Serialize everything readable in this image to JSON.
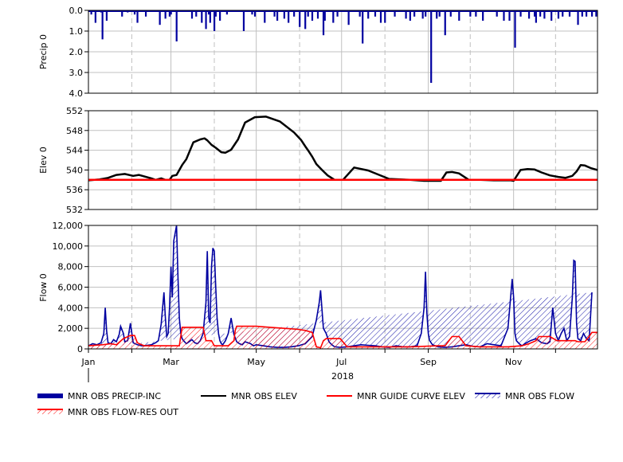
{
  "chart_data": [
    {
      "type": "bar",
      "ylabel": "Precip 0",
      "ylim": [
        0,
        4
      ],
      "y_inverted": true,
      "yticks": [
        "0.0",
        "1.0",
        "2.0",
        "3.0",
        "4.0"
      ],
      "grid": true,
      "series": [
        {
          "name": "MNR OBS PRECIP-INC",
          "color": "#0000a0",
          "x_day": [
            2,
            5,
            9,
            10,
            13,
            24,
            28,
            33,
            35,
            41,
            51,
            55,
            58,
            59,
            63,
            74,
            77,
            81,
            84,
            86,
            87,
            90,
            91,
            94,
            99,
            111,
            117,
            119,
            126,
            133,
            135,
            140,
            143,
            147,
            151,
            155,
            157,
            160,
            164,
            168,
            169,
            175,
            178,
            186,
            194,
            196,
            200,
            205,
            209,
            212,
            219,
            227,
            230,
            233,
            239,
            241,
            245,
            249,
            251,
            255,
            259,
            265,
            273,
            277,
            282,
            292,
            297,
            301,
            305,
            309,
            315,
            319,
            320,
            323,
            326,
            331,
            336,
            339,
            344,
            350,
            353,
            356,
            360,
            363
          ],
          "values": [
            0.2,
            0.6,
            0.1,
            1.4,
            0.5,
            0.3,
            0.1,
            0.2,
            0.6,
            0.3,
            0.7,
            0.4,
            0.3,
            0.2,
            1.5,
            0.4,
            0.3,
            0.6,
            0.9,
            0.2,
            0.6,
            1.0,
            0.3,
            0.5,
            0.2,
            1.0,
            0.2,
            0.3,
            0.6,
            0.3,
            0.5,
            0.4,
            0.6,
            0.3,
            0.8,
            0.9,
            0.3,
            0.5,
            0.4,
            1.2,
            0.5,
            0.6,
            0.3,
            0.7,
            0.3,
            1.6,
            0.4,
            0.3,
            0.6,
            0.6,
            0.3,
            0.4,
            0.5,
            0.3,
            0.4,
            0.3,
            3.5,
            0.4,
            0.3,
            1.2,
            0.3,
            0.5,
            0.3,
            0.3,
            0.5,
            0.3,
            0.5,
            0.5,
            1.8,
            0.3,
            0.4,
            0.3,
            0.6,
            0.3,
            0.4,
            0.5,
            0.4,
            0.3,
            0.3,
            0.7,
            0.3,
            0.3,
            0.3,
            0.3
          ]
        }
      ]
    },
    {
      "type": "line",
      "ylabel": "Elev 0",
      "ylim": [
        532,
        552
      ],
      "yticks": [
        "532",
        "536",
        "540",
        "544",
        "548",
        "552"
      ],
      "grid": true,
      "series": [
        {
          "name": "MNR OBS ELEV",
          "color": "#000000",
          "x_day": [
            0,
            8,
            14,
            20,
            26,
            32,
            36,
            45,
            48,
            52,
            55,
            58,
            60,
            63,
            67,
            70,
            75,
            80,
            83,
            85,
            88,
            91,
            95,
            98,
            102,
            107,
            112,
            119,
            127,
            137,
            147,
            152,
            155,
            157,
            160,
            163,
            167,
            171,
            176,
            182,
            190,
            200,
            215,
            230,
            240,
            244,
            248,
            252,
            256,
            260,
            265,
            272,
            280,
            290,
            302,
            304,
            309,
            314,
            319,
            324,
            330,
            336,
            341,
            346,
            349,
            352,
            355,
            359,
            364
          ],
          "values": [
            537.9,
            538.1,
            538.4,
            539.0,
            539.2,
            538.8,
            539.0,
            538.3,
            538.0,
            538.3,
            538.0,
            538.0,
            538.8,
            539.0,
            541.0,
            542.2,
            545.6,
            546.2,
            546.4,
            546.0,
            545.1,
            544.5,
            543.6,
            543.5,
            544.1,
            546.2,
            549.6,
            550.7,
            550.8,
            549.8,
            547.6,
            546.1,
            544.8,
            544.0,
            542.7,
            541.2,
            540.0,
            538.9,
            538.0,
            538.0,
            540.5,
            539.9,
            538.2,
            538.0,
            537.8,
            537.8,
            537.8,
            537.8,
            539.5,
            539.6,
            539.3,
            538.0,
            538.0,
            537.9,
            537.9,
            537.8,
            540.0,
            540.2,
            540.1,
            539.5,
            538.9,
            538.6,
            538.4,
            538.8,
            539.7,
            541.0,
            540.9,
            540.4,
            540.0
          ]
        },
        {
          "name": "MNR GUIDE CURVE ELEV",
          "color": "#ff0000",
          "x_day": [
            0,
            364
          ],
          "values": [
            538.0,
            538.0
          ]
        }
      ]
    },
    {
      "type": "area",
      "ylabel": "Flow 0",
      "xlabel": "2018",
      "ylim": [
        0,
        12000
      ],
      "yticks": [
        "0",
        "2,000",
        "4,000",
        "6,000",
        "8,000",
        "10,000",
        "12,000"
      ],
      "x_tick_labels": [
        "Jan",
        "Mar",
        "May",
        "Jul",
        "Sep",
        "Nov"
      ],
      "grid": true,
      "series": [
        {
          "name": "MNR OBS FLOW",
          "color": "#0000a0",
          "fill": "hatched",
          "x_day": [
            0,
            3,
            6,
            9,
            11,
            12,
            13,
            14,
            16,
            18,
            20,
            22,
            23,
            25,
            26,
            28,
            30,
            32,
            35,
            38,
            40,
            45,
            48,
            50,
            52,
            54,
            55,
            56,
            57,
            58,
            59,
            60,
            61,
            63,
            64,
            65,
            66,
            67,
            68,
            70,
            72,
            74,
            76,
            78,
            80,
            82,
            84,
            85,
            86,
            87,
            88,
            89,
            90,
            91,
            92,
            93,
            94,
            95,
            96,
            98,
            100,
            102,
            104,
            106,
            108,
            110,
            112,
            114,
            116,
            118,
            120,
            125,
            130,
            135,
            140,
            145,
            150,
            155,
            160,
            163,
            165,
            166,
            168,
            170,
            172,
            174,
            176,
            180,
            185,
            190,
            195,
            200,
            205,
            210,
            215,
            220,
            225,
            230,
            235,
            238,
            240,
            241,
            242,
            243,
            244,
            246,
            248,
            250,
            255,
            260,
            265,
            270,
            275,
            280,
            285,
            290,
            295,
            300,
            303,
            304,
            305,
            306,
            308,
            310,
            312,
            316,
            320,
            324,
            328,
            330,
            332,
            334,
            336,
            338,
            340,
            342,
            344,
            346,
            347,
            348,
            349,
            350,
            352,
            354,
            356,
            358,
            360,
            362,
            364
          ],
          "values": [
            300,
            500,
            400,
            600,
            1500,
            4000,
            1800,
            600,
            500,
            900,
            700,
            1400,
            2200,
            1500,
            700,
            800,
            2500,
            600,
            400,
            300,
            300,
            400,
            600,
            800,
            2400,
            5500,
            3000,
            1200,
            1500,
            4000,
            8000,
            5000,
            10500,
            12000,
            7000,
            3000,
            1500,
            1000,
            800,
            500,
            700,
            900,
            600,
            500,
            800,
            1500,
            4500,
            9500,
            3000,
            2500,
            8000,
            9800,
            9500,
            6000,
            3000,
            1500,
            800,
            500,
            400,
            800,
            1500,
            3000,
            1400,
            700,
            500,
            400,
            700,
            600,
            500,
            300,
            400,
            300,
            200,
            150,
            150,
            200,
            300,
            500,
            1200,
            2800,
            4500,
            5700,
            2000,
            1500,
            700,
            400,
            200,
            150,
            200,
            300,
            400,
            350,
            300,
            200,
            150,
            300,
            200,
            200,
            300,
            1500,
            4000,
            7500,
            3500,
            1500,
            800,
            400,
            300,
            200,
            150,
            200,
            300,
            400,
            250,
            200,
            500,
            400,
            300,
            2000,
            6800,
            5000,
            1500,
            800,
            500,
            300,
            500,
            800,
            1000,
            600,
            500,
            700,
            4000,
            1500,
            800,
            1500,
            2000,
            800,
            1200,
            5000,
            8600,
            8500,
            2500,
            1000,
            800,
            1500,
            1000,
            800,
            5500
          ]
        },
        {
          "name": "MNR OBS FLOW-RES OUT",
          "color": "#ff0000",
          "fill": "hatched",
          "x_day": [
            0,
            10,
            16,
            20,
            25,
            30,
            33,
            35,
            38,
            40,
            48,
            55,
            65,
            67,
            68,
            70,
            82,
            84,
            86,
            87,
            88,
            90,
            91,
            92,
            94,
            100,
            104,
            105,
            106,
            108,
            115,
            120,
            130,
            140,
            150,
            155,
            160,
            163,
            165,
            166,
            168,
            170,
            175,
            180,
            185,
            190,
            200,
            230,
            250,
            255,
            260,
            262,
            265,
            270,
            280,
            300,
            310,
            315,
            320,
            322,
            325,
            330,
            335,
            340,
            348,
            350,
            355,
            358,
            360,
            364
          ],
          "values": [
            300,
            400,
            500,
            400,
            1000,
            1300,
            1300,
            600,
            400,
            300,
            300,
            300,
            300,
            2100,
            2100,
            2100,
            2100,
            800,
            800,
            800,
            800,
            300,
            300,
            300,
            300,
            300,
            800,
            1800,
            2200,
            2200,
            2200,
            2200,
            2100,
            2000,
            1900,
            1800,
            1600,
            200,
            150,
            100,
            800,
            1000,
            1000,
            1000,
            200,
            200,
            200,
            200,
            300,
            300,
            1200,
            1200,
            1200,
            300,
            200,
            200,
            300,
            500,
            800,
            1200,
            1200,
            1200,
            800,
            800,
            800,
            700,
            700,
            1200,
            1600,
            1600
          ]
        }
      ]
    }
  ],
  "legend": {
    "items": [
      {
        "name": "MNR OBS PRECIP-INC",
        "kind": "thick-bar",
        "color": "#0000a0"
      },
      {
        "name": "MNR OBS ELEV",
        "kind": "line",
        "color": "#000000"
      },
      {
        "name": "MNR GUIDE CURVE ELEV",
        "kind": "line",
        "color": "#ff0000"
      },
      {
        "name": "MNR OBS FLOW",
        "kind": "hatch",
        "color": "#0000a0"
      },
      {
        "name": "MNR OBS FLOW-RES OUT",
        "kind": "hatch",
        "color": "#ff0000"
      }
    ]
  }
}
